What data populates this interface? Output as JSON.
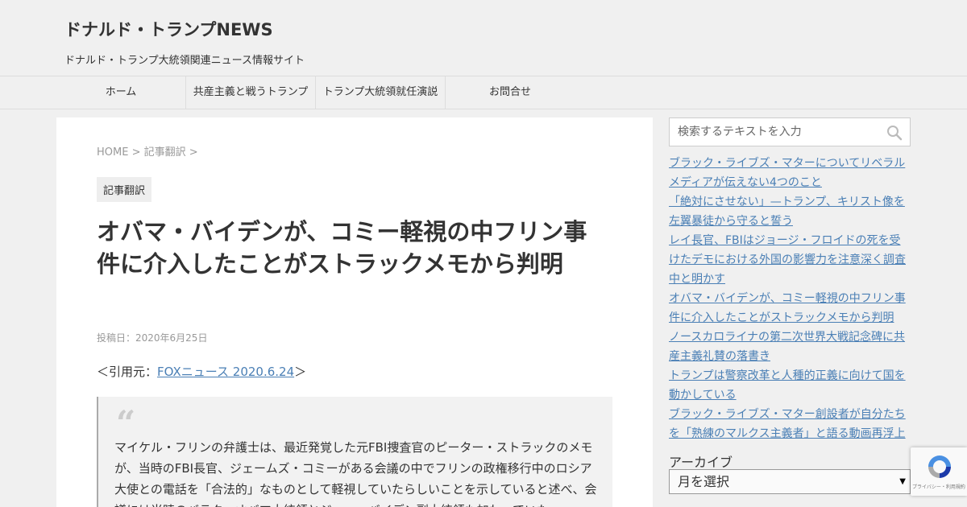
{
  "header": {
    "site_title": "ドナルド・トランプNEWS",
    "site_description": "ドナルド・トランプ大統領関連ニュース情報サイト"
  },
  "nav": {
    "items": [
      {
        "label": "ホーム"
      },
      {
        "label": "共産主義と戦うトランプ"
      },
      {
        "label": "トランプ大統領就任演説"
      },
      {
        "label": "お問合せ"
      }
    ]
  },
  "breadcrumb": {
    "home": "HOME",
    "sep1": " > ",
    "category": "記事翻訳",
    "sep2": " >"
  },
  "article": {
    "category_badge": "記事翻訳",
    "title": "オバマ・バイデンが、コミー軽視の中フリン事件に介入したことがストラックメモから判明",
    "date": "投稿日：2020年6月25日",
    "source_prefix": "＜引用元：",
    "source_link": "FOXニュース 2020.6.24",
    "source_suffix": "＞",
    "quote_mark": "“",
    "quote_text": "マイケル・フリンの弁護士は、最近発覚した元FBI捜査官のピーター・ストラックのメモが、当時のFBI長官、ジェームズ・コミーがある会議の中でフリンの政権移行中のロシア大使との電話を「合法的」なものとして軽視していたらしいことを示していると述べ、会議には当時のバラク・オバマ大統領とジョー・バイデン副大統領も加わっていた。"
  },
  "sidebar": {
    "search_placeholder": "検索するテキストを入力",
    "search_icon": "magnifier-icon",
    "recent_posts": [
      "ブラック・ライブズ・マターについてリベラルメディアが伝えない4つのこと",
      "「絶対にさせない」—トランプ、キリスト像を左翼暴徒から守ると誓う",
      "レイ長官、FBIはジョージ・フロイドの死を受けたデモにおける外国の影響力を注意深く調査中と明かす",
      "オバマ・バイデンが、コミー軽視の中フリン事件に介入したことがストラックメモから判明",
      "ノースカロライナの第二次世界大戦記念碑に共産主義礼賛の落書き",
      "トランプは警察改革と人種的正義に向けて国を動かしている",
      "ブラック・ライブズ・マター創設者が自分たちを「熟練のマルクス主義者」と語る動画再浮上"
    ],
    "archive_title": "アーカイブ",
    "archive_select": "月を選択"
  },
  "recaptcha": {
    "text": "プライバシー・利用規約"
  },
  "colors": {
    "link": "#4a7fb5",
    "background": "#f0f0f0",
    "text": "#333333"
  }
}
